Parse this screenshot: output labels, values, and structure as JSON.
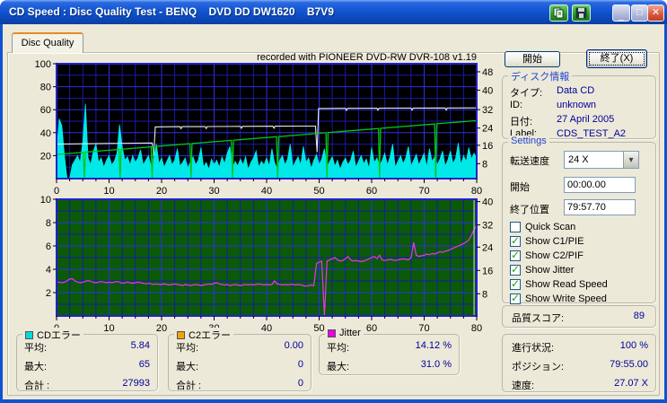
{
  "window": {
    "title": "CD Speed : Disc Quality Test - BENQ    DVD DD DW1620    B7V9",
    "controls": {
      "copy_icon": "copy-to-clipboard",
      "save_icon": "save-results",
      "minimize": "_",
      "maximize": "□",
      "close": "✕"
    }
  },
  "tab": {
    "label": "Disc Quality"
  },
  "buttons": {
    "start": "開始",
    "exit": "終了(X)"
  },
  "disc_info": {
    "title": "ディスク情報",
    "rows": [
      {
        "label": "タイプ:",
        "value": "Data CD"
      },
      {
        "label": "ID:",
        "value": "unknown"
      },
      {
        "label": "日付:",
        "value": "27 April 2005"
      },
      {
        "label": "Label:",
        "value": "CDS_TEST_A2"
      }
    ]
  },
  "settings": {
    "title": "Settings",
    "speed": {
      "label": "転送速度",
      "value": "24 X"
    },
    "start": {
      "label": "開始",
      "value": "00:00.00"
    },
    "end": {
      "label": "終了位置",
      "value": "79:57.70"
    },
    "checkboxes": [
      {
        "label": "Quick Scan",
        "checked": false
      },
      {
        "label": "Show C1/PIE",
        "checked": true
      },
      {
        "label": "Show C2/PIF",
        "checked": true
      },
      {
        "label": "Show Jitter",
        "checked": true
      },
      {
        "label": "Show Read Speed",
        "checked": true
      },
      {
        "label": "Show Write Speed",
        "checked": true
      }
    ]
  },
  "quality": {
    "label": "品質スコア:",
    "value": "89"
  },
  "progress": {
    "rows": [
      {
        "label": "進行状況:",
        "value": "100 %"
      },
      {
        "label": "ポジション:",
        "value": "79:55.00"
      },
      {
        "label": "速度:",
        "value": "27.07 X"
      }
    ]
  },
  "stats": [
    {
      "title": "CDエラー",
      "color": "#00dcdc",
      "rows": [
        {
          "label": "平均:",
          "value": "5.84"
        },
        {
          "label": "最大:",
          "value": "65"
        },
        {
          "label": "合計 :",
          "value": "27993"
        }
      ]
    },
    {
      "title": "C2エラー",
      "color": "#efa400",
      "rows": [
        {
          "label": "平均:",
          "value": "0.00"
        },
        {
          "label": "最大:",
          "value": "0"
        },
        {
          "label": "合計 :",
          "value": "0"
        }
      ]
    },
    {
      "title": "Jitter",
      "color": "#e800e8",
      "rows": [
        {
          "label": "平均:",
          "value": "14.12 %"
        },
        {
          "label": "最大:",
          "value": "31.0 %"
        }
      ]
    }
  ],
  "chart_data": [
    {
      "type": "area+line",
      "title": "recorded with PIONEER DVD-RW  DVR-108  v1.19",
      "x": {
        "min": 0,
        "max": 80,
        "tick_step": 10,
        "minor_step": 2.5
      },
      "left_axis": {
        "min": 0,
        "max": 100,
        "ticks": [
          20,
          40,
          60,
          80,
          100
        ]
      },
      "right_axis": {
        "ticks": [
          48,
          40,
          32,
          24,
          16,
          8
        ],
        "tick_fractions": [
          0.07,
          0.23,
          0.4,
          0.56,
          0.71,
          0.87
        ]
      },
      "colors": {
        "bg": "#000000",
        "grid_major": "#3030e0",
        "grid_minor": "#1a1aa6",
        "border": "#2222cc"
      },
      "series": [
        {
          "name": "C1/PIE errors",
          "type": "area",
          "color": "#00e8e8",
          "x_start": 0,
          "x_step": 0.5,
          "values": [
            22,
            52,
            46,
            20,
            0,
            0,
            12,
            16,
            20,
            14,
            33,
            65,
            18,
            12,
            24,
            30,
            14,
            18,
            10,
            16,
            20,
            12,
            15,
            22,
            47,
            28,
            16,
            19,
            12,
            20,
            14,
            18,
            25,
            12,
            16,
            20,
            11,
            17,
            30,
            13,
            18,
            10,
            15,
            20,
            12,
            16,
            26,
            11,
            14,
            18,
            9,
            15,
            19,
            12,
            16,
            27,
            10,
            14,
            8,
            17,
            12,
            16,
            10,
            19,
            13,
            22,
            28,
            9,
            15,
            11,
            17,
            12,
            19,
            8,
            14,
            18,
            24,
            10,
            15,
            12,
            18,
            11,
            26,
            14,
            9,
            16,
            20,
            12,
            17,
            30,
            10,
            15,
            19,
            12,
            28,
            14,
            18,
            9,
            16,
            21,
            12,
            17,
            26,
            10,
            15,
            19,
            11,
            16,
            8,
            14,
            18,
            12,
            16,
            24,
            10,
            15,
            20,
            13,
            17,
            9,
            27,
            14,
            18,
            11,
            16,
            22,
            12,
            19,
            30,
            10,
            15,
            20,
            13,
            18,
            28,
            11,
            16,
            21,
            12,
            17,
            22,
            10,
            26,
            15,
            19,
            12,
            17,
            24,
            11,
            16,
            24,
            13,
            18,
            31,
            12,
            20,
            15,
            27,
            17,
            22,
            18
          ]
        },
        {
          "name": "Read Speed",
          "type": "line",
          "color": "#e8e8e8",
          "points": [
            [
              0,
              30
            ],
            [
              5,
              30.3
            ],
            [
              10,
              30.6
            ],
            [
              18.2,
              31
            ],
            [
              18.5,
              20
            ],
            [
              18.8,
              45
            ],
            [
              23.5,
              45.2
            ],
            [
              23.7,
              43.5
            ],
            [
              23.9,
              45.2
            ],
            [
              28.3,
              45.3
            ],
            [
              28.5,
              43.6
            ],
            [
              28.7,
              45.3
            ],
            [
              35,
              45.5
            ],
            [
              35.2,
              43.8
            ],
            [
              35.4,
              45.5
            ],
            [
              41.2,
              45.6
            ],
            [
              41.4,
              43.9
            ],
            [
              41.6,
              45.6
            ],
            [
              46,
              45.7
            ],
            [
              49.3,
              45.7
            ],
            [
              49.6,
              23
            ],
            [
              49.9,
              61
            ],
            [
              55,
              61.2
            ],
            [
              55.2,
              59.4
            ],
            [
              55.4,
              61.2
            ],
            [
              61,
              61.3
            ],
            [
              61.2,
              59.5
            ],
            [
              61.4,
              61.3
            ],
            [
              67.5,
              61.4
            ],
            [
              67.7,
              59.6
            ],
            [
              67.9,
              61.4
            ],
            [
              74,
              61.5
            ],
            [
              74.2,
              59.7
            ],
            [
              74.4,
              61.5
            ],
            [
              80,
              61.6
            ]
          ]
        },
        {
          "name": "Write Speed",
          "type": "line-with-dips",
          "color": "#00c818",
          "start": [
            0,
            21
          ],
          "end": [
            80,
            50.5
          ],
          "dips": [
            5.3,
            12.1,
            18.2,
            25.6,
            33.5,
            42.1,
            51.5,
            61.5,
            72.2
          ]
        }
      ]
    },
    {
      "type": "line",
      "title": "",
      "x": {
        "min": 0,
        "max": 80,
        "tick_step": 10,
        "minor_step": 2.5
      },
      "left_axis": {
        "min": 0,
        "max": 10,
        "ticks": [
          2,
          4,
          6,
          8,
          10
        ]
      },
      "right_axis": {
        "ticks": [
          40,
          32,
          24,
          16,
          8
        ],
        "tick_fractions": [
          0.02,
          0.22,
          0.41,
          0.61,
          0.81
        ]
      },
      "colors": {
        "bg": "#0a5a0a",
        "grid_major": "#3030e0",
        "grid_minor": "#1a1aa6",
        "border": "#2222cc",
        "cursor": "#dcdcdc"
      },
      "cursor_x": 79.5,
      "series": [
        {
          "name": "Jitter",
          "type": "line",
          "color": "#f030f0",
          "x_start": 0,
          "x_step": 0.5,
          "values": [
            2.9,
            2.9,
            2.85,
            2.9,
            3.0,
            3.15,
            3.2,
            3.0,
            2.9,
            2.85,
            2.9,
            2.95,
            3.05,
            2.95,
            2.9,
            2.85,
            2.9,
            2.95,
            2.9,
            2.85,
            2.9,
            2.85,
            2.9,
            2.95,
            2.9,
            2.8,
            2.85,
            2.9,
            2.85,
            2.8,
            2.85,
            2.9,
            2.85,
            2.8,
            2.75,
            2.8,
            2.75,
            2.7,
            2.75,
            2.7,
            2.7,
            2.75,
            2.7,
            2.65,
            2.7,
            2.75,
            2.7,
            2.65,
            2.6,
            2.7,
            2.65,
            2.6,
            2.65,
            2.7,
            2.65,
            2.6,
            2.65,
            2.7,
            2.75,
            2.7,
            2.8,
            2.85,
            2.75,
            2.7,
            2.65,
            2.7,
            2.6,
            2.65,
            2.7,
            2.65,
            2.6,
            2.65,
            2.7,
            2.65,
            2.7,
            2.65,
            2.7,
            2.75,
            2.7,
            2.65,
            2.7,
            2.65,
            2.7,
            3.0,
            2.75,
            2.7,
            2.65,
            2.7,
            2.65,
            2.7,
            2.7,
            2.65,
            2.7,
            2.65,
            2.6,
            2.55,
            2.6,
            2.65,
            2.6,
            4.5,
            4.6,
            4.7,
            0.0,
            4.7,
            4.8,
            4.9,
            5.0,
            4.8,
            4.7,
            4.75,
            4.9,
            5.1,
            4.8,
            4.7,
            4.75,
            4.7,
            4.65,
            4.7,
            4.8,
            4.9,
            5.0,
            5.1,
            4.9,
            5.2,
            4.8,
            4.75,
            4.8,
            4.85,
            4.8,
            4.75,
            4.8,
            4.85,
            4.9,
            4.85,
            4.8,
            5.0,
            6.3,
            5.2,
            5.1,
            5.15,
            5.2,
            5.3,
            5.25,
            5.35,
            5.3,
            5.4,
            5.5,
            5.45,
            5.55,
            5.6,
            5.7,
            5.8,
            5.9,
            6.0,
            6.1,
            6.2,
            6.35,
            6.5,
            6.9,
            7.4,
            7.8
          ]
        }
      ]
    }
  ]
}
